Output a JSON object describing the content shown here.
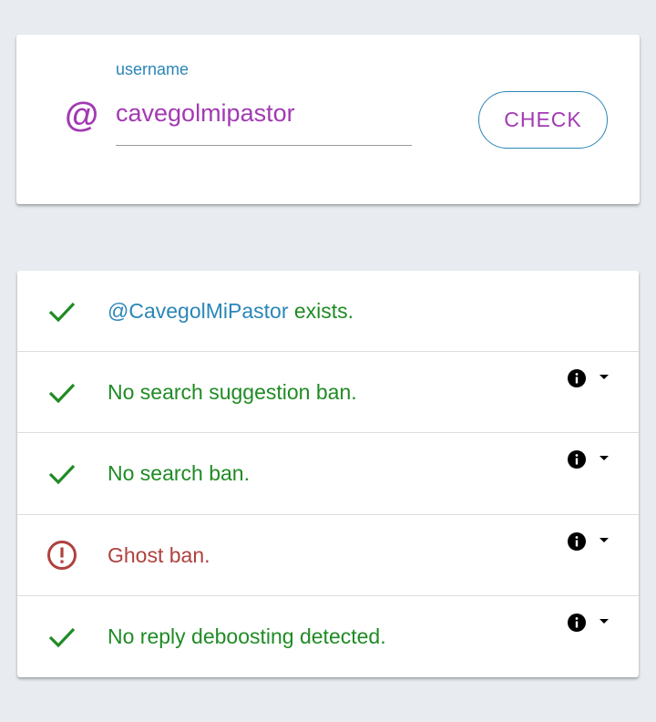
{
  "search": {
    "label": "username",
    "value": "cavegolmipastor",
    "at_symbol": "@",
    "button_label": "CHECK"
  },
  "results": {
    "exists": {
      "handle": "@CavegolMiPastor",
      "suffix": " exists.",
      "status": "ok"
    },
    "rows": [
      {
        "text": "No search suggestion ban.",
        "status": "ok",
        "icon": "check-icon"
      },
      {
        "text": "No search ban.",
        "status": "ok",
        "icon": "check-icon"
      },
      {
        "text": "Ghost ban.",
        "status": "warning",
        "icon": "alert-circle-icon"
      },
      {
        "text": "No reply deboosting detected.",
        "status": "ok",
        "icon": "check-icon"
      }
    ]
  },
  "colors": {
    "ok": "#1f8b24",
    "warning": "#b0413e",
    "accent": "#a23ab3",
    "link": "#2a86b8",
    "background": "#e8ecf0"
  }
}
